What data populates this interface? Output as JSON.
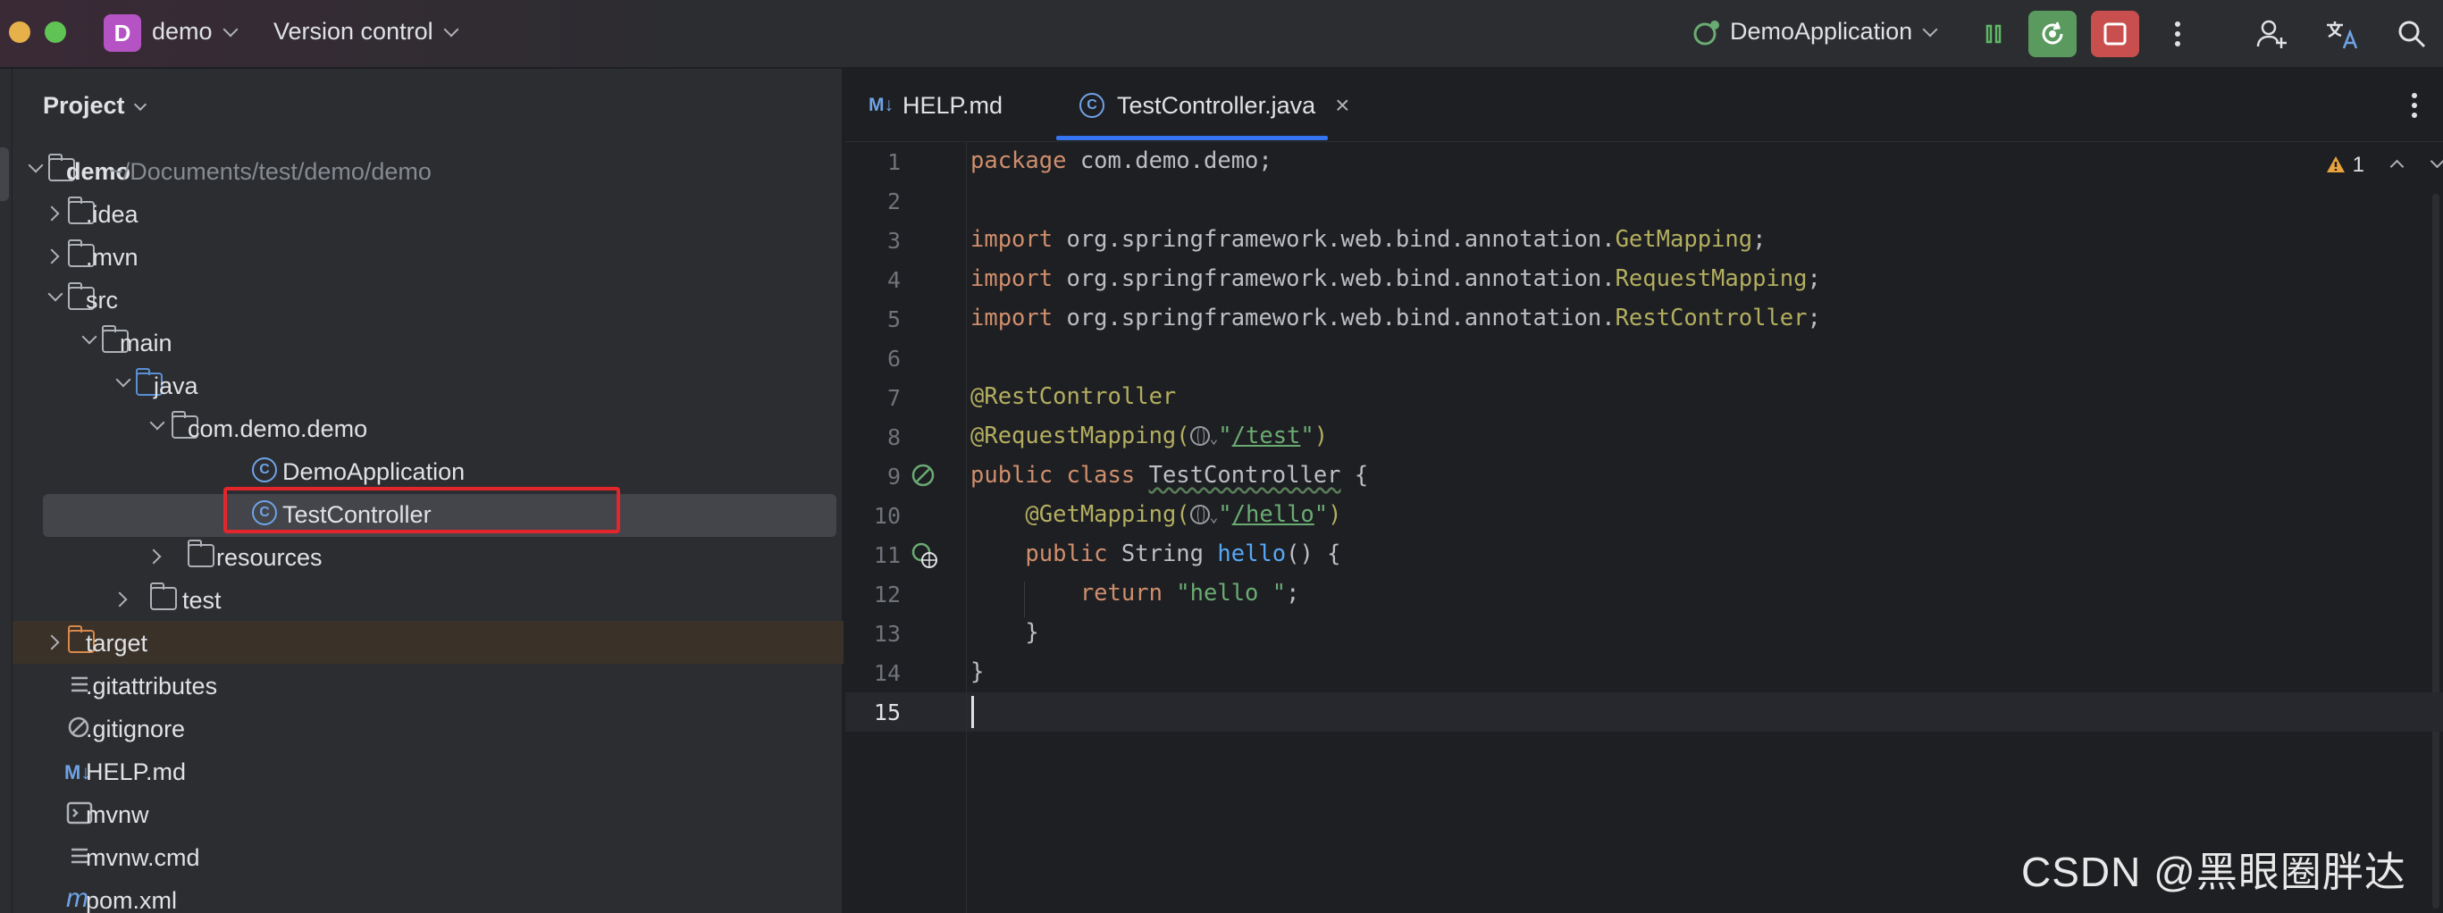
{
  "titlebar": {
    "project_badge": "D",
    "project_name": "demo",
    "vcs_label": "Version control",
    "run_config": "DemoApplication",
    "icons": [
      "pause-icon",
      "rerun-icon",
      "stop-icon",
      "more-icon",
      "add-user-icon",
      "translate-icon",
      "search-icon"
    ]
  },
  "project_panel": {
    "title": "Project",
    "tree": [
      {
        "name": "demo",
        "path": "~/Documents/test/demo/demo",
        "bold": true
      },
      {
        "name": ".idea"
      },
      {
        "name": ".mvn"
      },
      {
        "name": "src"
      },
      {
        "name": "main"
      },
      {
        "name": "java"
      },
      {
        "name": "com.demo.demo"
      },
      {
        "name": "DemoApplication"
      },
      {
        "name": "TestController"
      },
      {
        "name": "resources"
      },
      {
        "name": "test"
      },
      {
        "name": "target"
      },
      {
        "name": ".gitattributes"
      },
      {
        "name": ".gitignore"
      },
      {
        "name": "HELP.md"
      },
      {
        "name": "mvnw"
      },
      {
        "name": "mvnw.cmd"
      },
      {
        "name": "pom.xml"
      }
    ]
  },
  "editor": {
    "tabs": [
      {
        "label": "HELP.md",
        "icon": "M↓"
      },
      {
        "label": "TestController.java",
        "icon": "C",
        "active": true,
        "close": "×"
      }
    ],
    "warnings": "1",
    "line_numbers": [
      "1",
      "2",
      "3",
      "4",
      "5",
      "6",
      "7",
      "8",
      "9",
      "10",
      "11",
      "12",
      "13",
      "14",
      "15"
    ],
    "code": {
      "l1_kw": "package",
      "l1_rest": " com.demo.demo;",
      "l3_kw": "import",
      "l3_pkg": " org.springframework.web.bind.annotation.",
      "l3_cls": "GetMapping",
      "l3_end": ";",
      "l4_kw": "import",
      "l4_pkg": " org.springframework.web.bind.annotation.",
      "l4_cls": "RequestMapping",
      "l4_end": ";",
      "l5_kw": "import",
      "l5_pkg": " org.springframework.web.bind.annotation.",
      "l5_cls": "RestController",
      "l5_end": ";",
      "l7_ann": "@RestController",
      "l8_ann": "@RequestMapping(",
      "l8_q1": "\"",
      "l8_url": "/test",
      "l8_q2": "\"",
      "l8_end": ")",
      "l9_kw": "public class ",
      "l9_cls": "TestController",
      "l9_end": " {",
      "l10_ann": "@GetMapping(",
      "l10_q1": "\"",
      "l10_url": "/hello",
      "l10_q2": "\"",
      "l10_end": ")",
      "l11_kw": "public ",
      "l11_type": "String ",
      "l11_fn": "hello",
      "l11_end": "() {",
      "l12_kw": "return ",
      "l12_str": "\"hello \"",
      "l12_end": ";",
      "l13": "}",
      "l14": "}"
    }
  },
  "watermark": "CSDN @黑眼圈胖达"
}
